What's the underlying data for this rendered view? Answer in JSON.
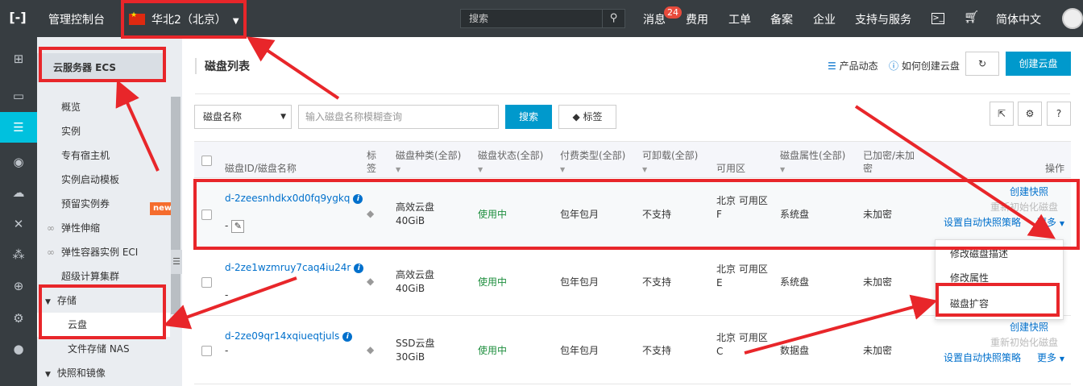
{
  "topbar": {
    "logo": "[-]",
    "console_title": "管理控制台",
    "region": "华北2（北京）",
    "search_placeholder": "搜索",
    "nav": [
      "消息",
      "费用",
      "工单",
      "备案",
      "企业",
      "支持与服务",
      "简体中文"
    ],
    "message_count": "24"
  },
  "sidebar": {
    "title": "云服务器 ECS",
    "items": [
      "概览",
      "实例",
      "专有宿主机",
      "实例启动模板",
      "预留实例券",
      "弹性伸缩",
      "弹性容器实例 ECI",
      "超级计算集群"
    ],
    "new_tag": "new",
    "group_storage": "存储",
    "storage_items": [
      "云盘",
      "文件存储 NAS"
    ],
    "group_snapshot": "快照和镜像"
  },
  "main": {
    "title": "磁盘列表",
    "product_news": "产品动态",
    "how_to_create": "如何创建云盘",
    "create_button": "创建云盘",
    "filter_select": "磁盘名称",
    "filter_placeholder": "输入磁盘名称模糊查询",
    "search_button": "搜索",
    "tag_button": "标签",
    "help_button": "?"
  },
  "table": {
    "headers": {
      "id": "磁盘ID/磁盘名称",
      "tag_1": "标",
      "tag_2": "签",
      "type": "磁盘种类(全部)",
      "status": "磁盘状态(全部)",
      "billing": "付费类型(全部)",
      "detachable": "可卸载(全部)",
      "zone": "可用区",
      "attr": "磁盘属性(全部)",
      "encrypt_1": "已加密/未加",
      "encrypt_2": "密",
      "ops": "操作"
    },
    "rows": [
      {
        "id": "d-2zeesnhdkx0d0fq9ygkq",
        "name": "-",
        "type": "高效云盘",
        "size": "40GiB",
        "status": "使用中",
        "billing": "包年包月",
        "detachable": "不支持",
        "zone_1": "北京 可用区",
        "zone_2": "F",
        "attr": "系统盘",
        "encrypt": "未加密",
        "op_snapshot": "创建快照",
        "op_reinit": "重新初始化磁盘",
        "op_policy": "设置自动快照策略",
        "op_more": "更多"
      },
      {
        "id": "d-2ze1wzmruy7caq4iu24r",
        "name": "-",
        "type": "高效云盘",
        "size": "40GiB",
        "status": "使用中",
        "billing": "包年包月",
        "detachable": "不支持",
        "zone_1": "北京 可用区",
        "zone_2": "E",
        "attr": "系统盘",
        "encrypt": "未加密"
      },
      {
        "id": "d-2ze09qr14xqiueqtjuls",
        "name": "-",
        "type": "SSD云盘",
        "size": "30GiB",
        "status": "使用中",
        "billing": "包年包月",
        "detachable": "不支持",
        "zone_1": "北京 可用区",
        "zone_2": "C",
        "attr": "数据盘",
        "encrypt": "未加密",
        "op_snapshot": "创建快照",
        "op_reinit": "重新初始化磁盘",
        "op_policy": "设置自动快照策略",
        "op_more": "更多"
      }
    ]
  },
  "dropdown": {
    "items": [
      "修改磁盘描述",
      "修改属性",
      "磁盘扩容"
    ]
  },
  "colors": {
    "topbar": "#373d41",
    "accent": "#00c1de",
    "primary": "#0099cc",
    "annotation": "#e8262a",
    "status_green": "#1e8e3e"
  },
  "icons": [
    "grid-icon",
    "message-icon",
    "server-icon",
    "database-icon",
    "cloud-icon",
    "network-icon",
    "cluster-icon",
    "globe-icon",
    "tools-icon",
    "search-icon",
    "terminal-icon",
    "cart-icon",
    "tag-icon",
    "info-icon",
    "pencil-icon",
    "refresh-icon",
    "export-icon",
    "gear-icon"
  ]
}
